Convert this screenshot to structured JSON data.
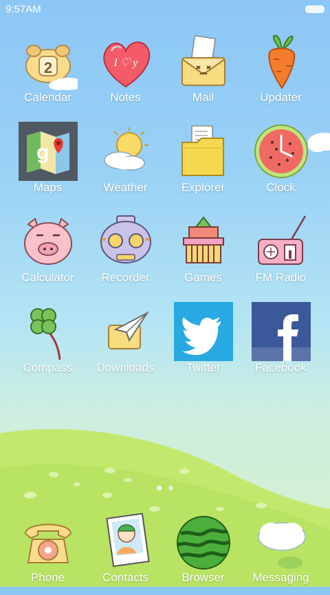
{
  "status_bar": {
    "time": "9:57AM",
    "battery_icon": "battery-icon"
  },
  "apps": [
    {
      "label": "Calendar",
      "icon": "calendar-icon",
      "text": "2"
    },
    {
      "label": "Notes",
      "icon": "notes-icon",
      "text": "I ♡ y"
    },
    {
      "label": "Mail",
      "icon": "mail-icon"
    },
    {
      "label": "Updater",
      "icon": "updater-icon"
    },
    {
      "label": "Maps",
      "icon": "maps-icon"
    },
    {
      "label": "Weather",
      "icon": "weather-icon"
    },
    {
      "label": "Explorer",
      "icon": "explorer-icon"
    },
    {
      "label": "Clock",
      "icon": "clock-icon"
    },
    {
      "label": "Calculator",
      "icon": "calculator-icon"
    },
    {
      "label": "Recorder",
      "icon": "recorder-icon"
    },
    {
      "label": "Games",
      "icon": "games-icon"
    },
    {
      "label": "FM Radio",
      "icon": "fm-radio-icon"
    },
    {
      "label": "Compass",
      "icon": "compass-icon"
    },
    {
      "label": "Downloads",
      "icon": "downloads-icon"
    },
    {
      "label": "Twitter",
      "icon": "twitter-icon"
    },
    {
      "label": "Facebook",
      "icon": "facebook-icon"
    }
  ],
  "dock": [
    {
      "label": "Phone",
      "icon": "phone-icon"
    },
    {
      "label": "Contacts",
      "icon": "contacts-icon"
    },
    {
      "label": "Browser",
      "icon": "browser-icon"
    },
    {
      "label": "Messaging",
      "icon": "messaging-icon"
    }
  ],
  "page_indicator": {
    "pages": 2,
    "current": 1
  },
  "colors": {
    "sky": "#8cc6f5",
    "grass": "#bfe66a",
    "twitter": "#2aa9e0",
    "facebook": "#3b5998"
  }
}
